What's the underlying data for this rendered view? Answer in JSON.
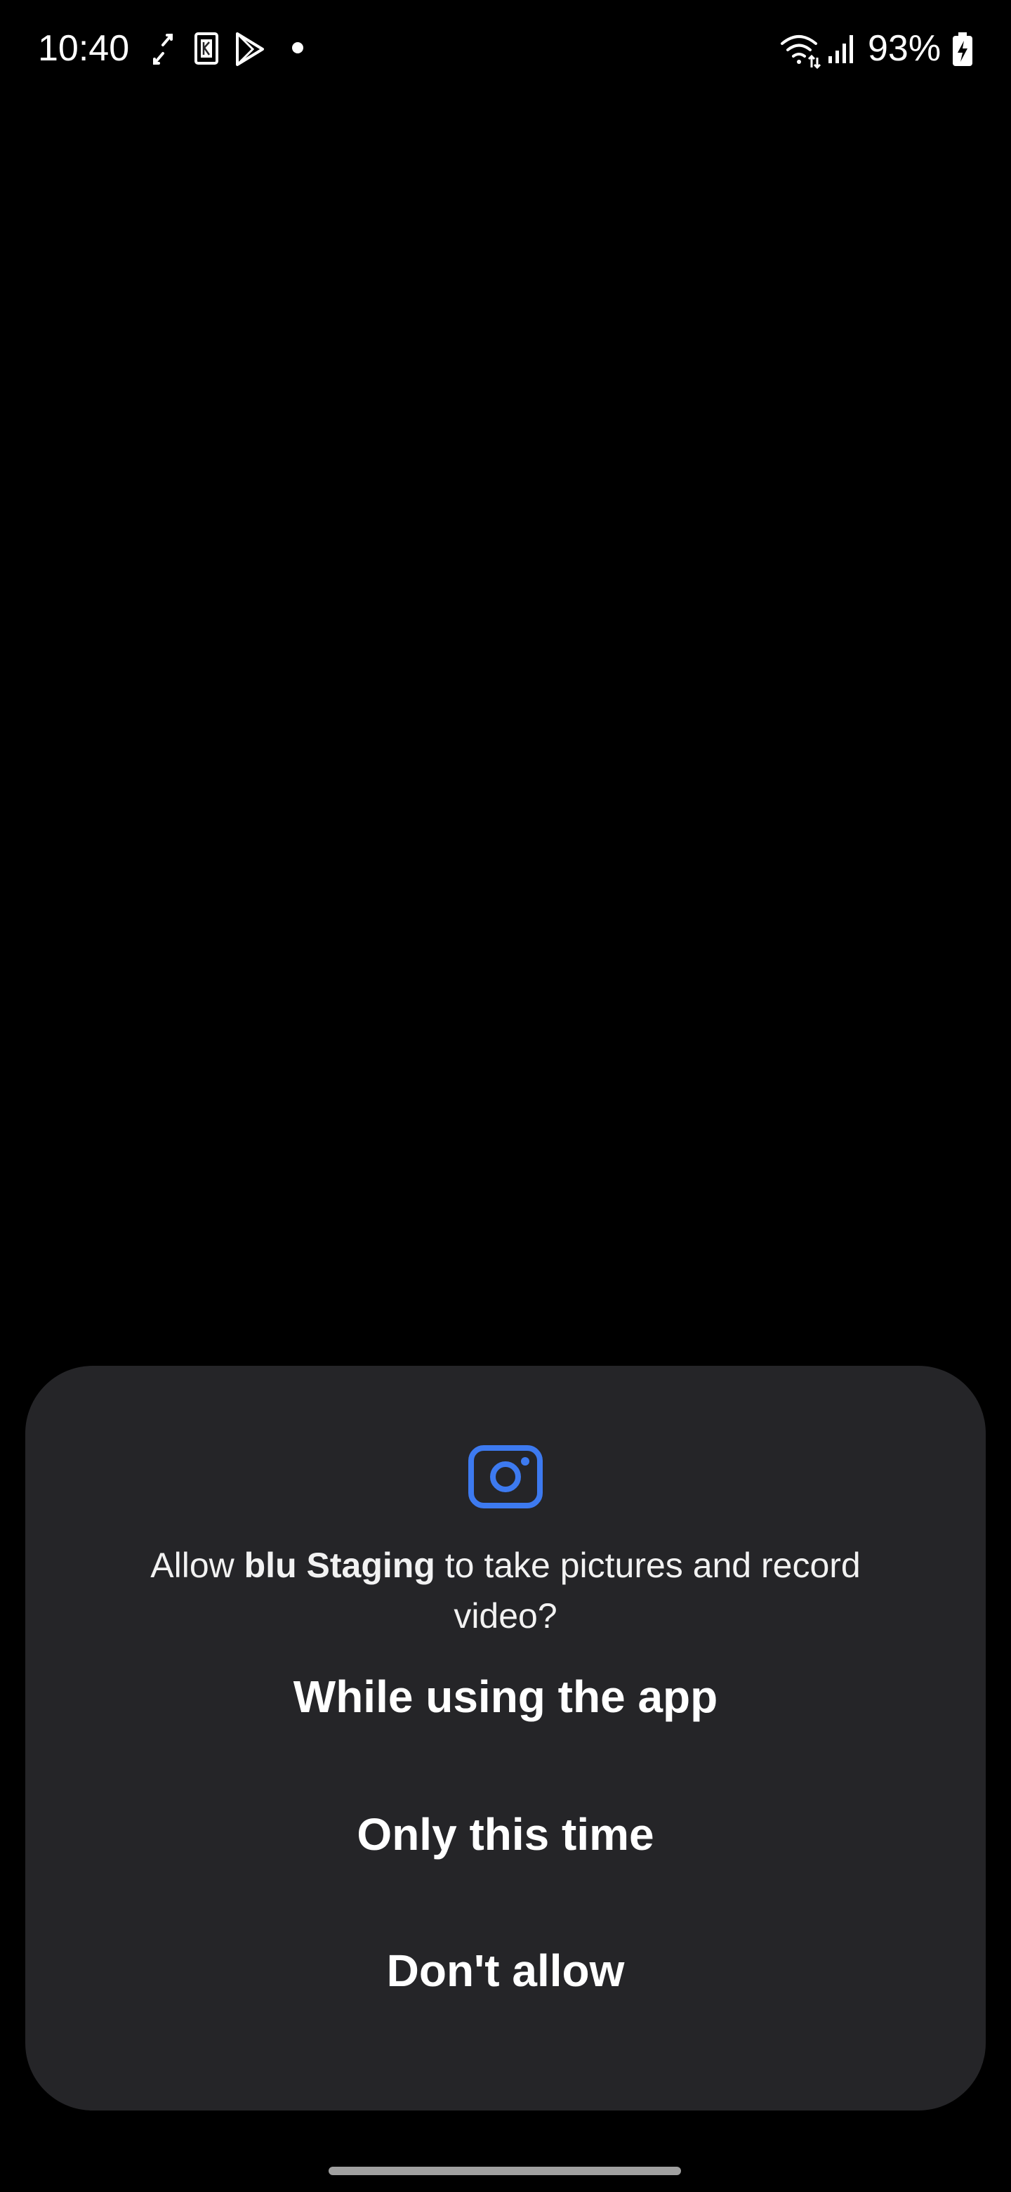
{
  "status_bar": {
    "time": "10:40",
    "left_icons": [
      "sync-icon",
      "k-app-icon",
      "play-store-icon",
      "notification-dot-icon"
    ],
    "right_icons": [
      "wifi-icon",
      "signal-icon",
      "battery-charging-icon"
    ],
    "battery": "93%"
  },
  "dialog": {
    "icon": "camera-icon",
    "accent_color": "#3d7af0",
    "prompt_prefix": "Allow ",
    "app_name": "blu Staging",
    "prompt_suffix": " to take pictures and record video?",
    "options": {
      "while_using": "While using the app",
      "only_once": "Only this time",
      "deny": "Don't allow"
    }
  },
  "colors": {
    "background": "#000000",
    "dialog_bg": "#252528",
    "text": "#ffffff"
  }
}
